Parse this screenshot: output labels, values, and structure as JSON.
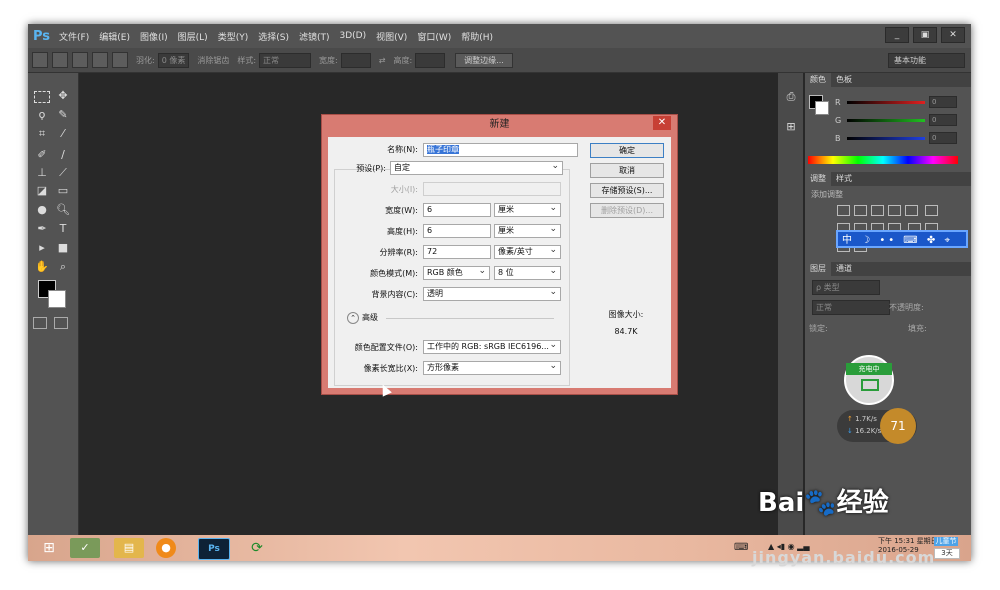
{
  "app": {
    "logo": "Ps"
  },
  "menu": {
    "items": [
      "文件(F)",
      "编辑(E)",
      "图像(I)",
      "图层(L)",
      "类型(Y)",
      "选择(S)",
      "滤镜(T)",
      "3D(D)",
      "视图(V)",
      "窗口(W)",
      "帮助(H)"
    ]
  },
  "window_controls": {
    "minimize": "_",
    "restore": "▣",
    "close": "✕"
  },
  "options_bar": {
    "feather_label": "羽化:",
    "feather_value": "0 像素",
    "antialias_label": "消除锯齿",
    "style_label": "样式:",
    "style_value": "正常",
    "width_label": "宽度:",
    "height_label": "高度:",
    "refine_edge": "调整边缘...",
    "workspace": "基本功能"
  },
  "panels": {
    "color_tabs": [
      "颜色",
      "色板"
    ],
    "channels": [
      {
        "label": "R",
        "value": "0",
        "color": "#e02020"
      },
      {
        "label": "G",
        "value": "0",
        "color": "#20c020"
      },
      {
        "label": "B",
        "value": "0",
        "color": "#2040e0"
      }
    ],
    "adjust_tabs": [
      "调整",
      "样式"
    ],
    "adjust_title": "添加调整",
    "layers_tabs": [
      "图层",
      "通道"
    ],
    "layers_kind": "ρ 类型",
    "blend_mode": "正常",
    "opacity_label": "不透明度:",
    "lock_label": "锁定:",
    "fill_label": "填充:"
  },
  "float_toolbar": {
    "text": "中 ☽ •• ⌨ ✤ ⌖"
  },
  "charging": {
    "label": "充电中"
  },
  "network": {
    "up": "1.7K/s",
    "down": "16.2K/s",
    "percent": "71"
  },
  "dialog": {
    "title": "新建",
    "close": "✕",
    "name_label": "名称(N):",
    "name_value": "瓶子印章",
    "preset_label": "预设(P):",
    "preset_value": "自定",
    "size_label": "大小(I):",
    "width_label": "宽度(W):",
    "width_value": "6",
    "width_unit": "厘米",
    "height_label": "高度(H):",
    "height_value": "6",
    "height_unit": "厘米",
    "resolution_label": "分辨率(R):",
    "resolution_value": "72",
    "resolution_unit": "像素/英寸",
    "color_mode_label": "颜色模式(M):",
    "color_mode_value": "RGB 颜色",
    "bit_depth": "8 位",
    "background_label": "背景内容(C):",
    "background_value": "透明",
    "advanced_label": "高级",
    "color_profile_label": "颜色配置文件(O):",
    "color_profile_value": "工作中的 RGB: sRGB IEC6196...",
    "pixel_aspect_label": "像素长宽比(X):",
    "pixel_aspect_value": "方形像素",
    "ok": "确定",
    "cancel": "取消",
    "save_preset": "存储预设(S)...",
    "delete_preset": "删除预设(D)...",
    "image_size_label": "图像大小:",
    "image_size_value": "84.7K"
  },
  "taskbar": {
    "clock_line1": "下午 15:31 星期日",
    "clock_line2": "2016-05-29",
    "badge1": "儿童节",
    "badge2": "3天"
  },
  "watermark": {
    "logo_text": "Bai🐾经验",
    "url": "jingyan.baidu.com"
  }
}
